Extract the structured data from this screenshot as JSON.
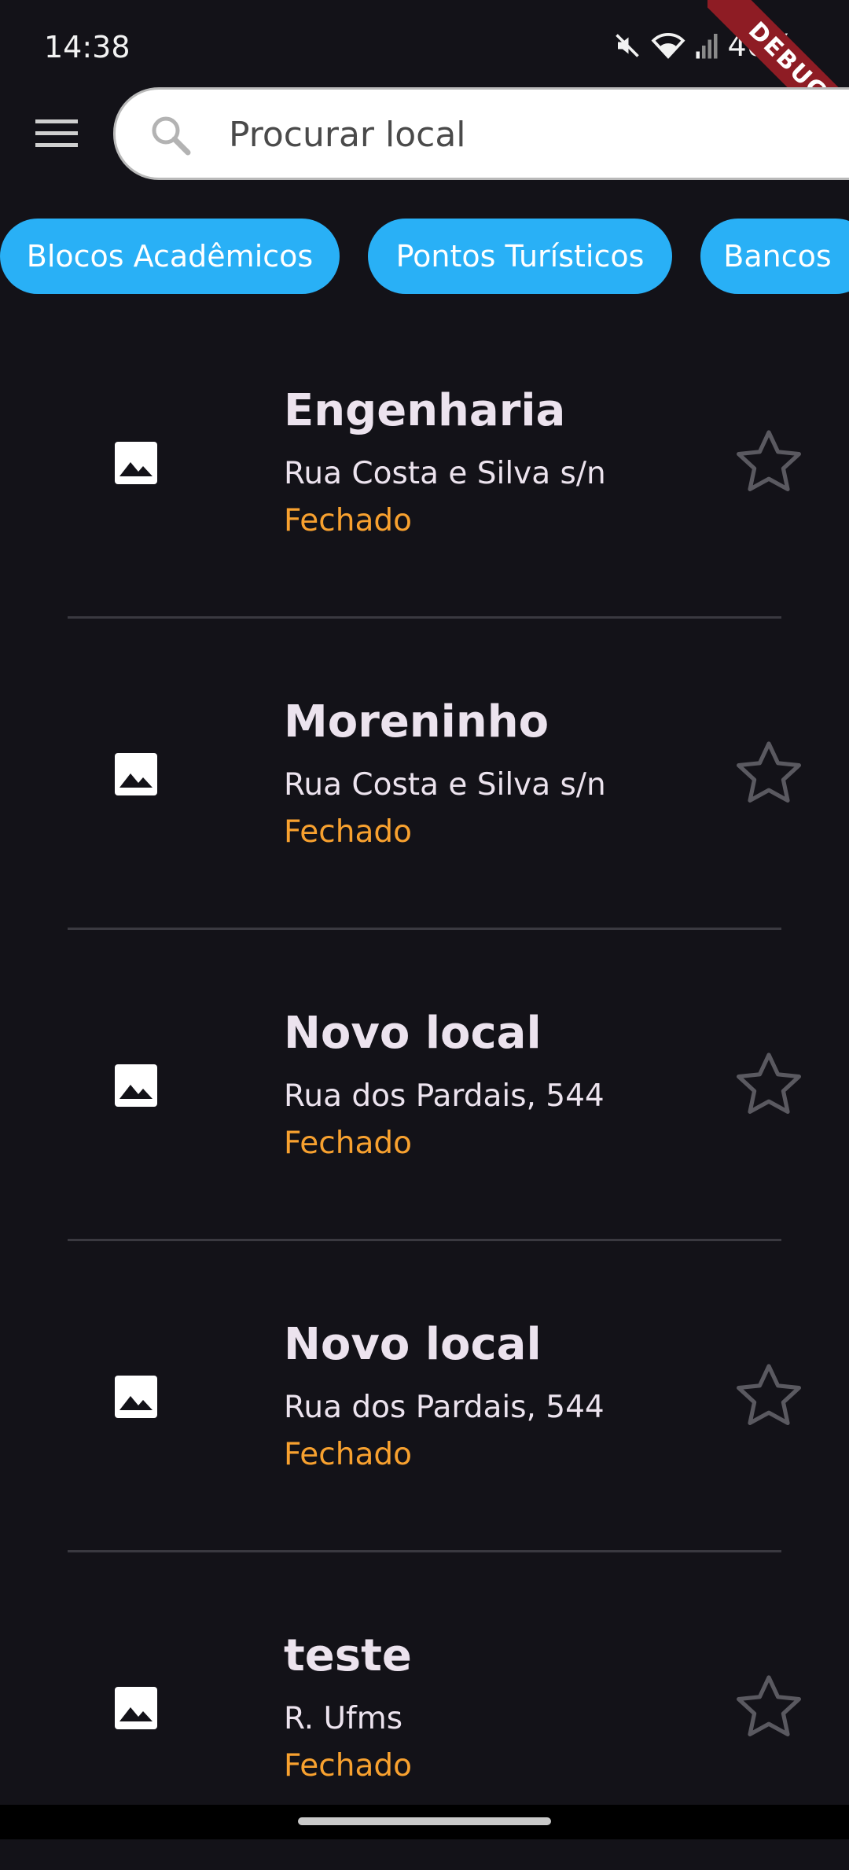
{
  "status_bar": {
    "time": "14:38",
    "battery": "46%",
    "icons": [
      "mute-icon",
      "wifi-icon",
      "signal-icon",
      "battery-icon"
    ]
  },
  "debug_banner": "DEBUG",
  "search": {
    "placeholder": "Procurar local",
    "value": ""
  },
  "menu_icon": "hamburger-menu-icon",
  "categories": [
    "Blocos Acadêmicos",
    "Pontos Turísticos",
    "Bancos"
  ],
  "places": [
    {
      "name": "Engenharia",
      "address": "Rua Costa e Silva s/n",
      "status": "Fechado"
    },
    {
      "name": "Moreninho",
      "address": "Rua Costa e Silva s/n",
      "status": "Fechado"
    },
    {
      "name": "Novo local",
      "address": "Rua dos Pardais, 544",
      "status": "Fechado"
    },
    {
      "name": "Novo local",
      "address": "Rua dos Pardais, 544",
      "status": "Fechado"
    },
    {
      "name": "teste",
      "address": "R. Ufms",
      "status": "Fechado"
    }
  ],
  "colors": {
    "background": "#131218",
    "chip": "#29B0F6",
    "status_closed": "#F8A12F",
    "text": "#ECE3EE",
    "star_outline": "#5A5960"
  }
}
